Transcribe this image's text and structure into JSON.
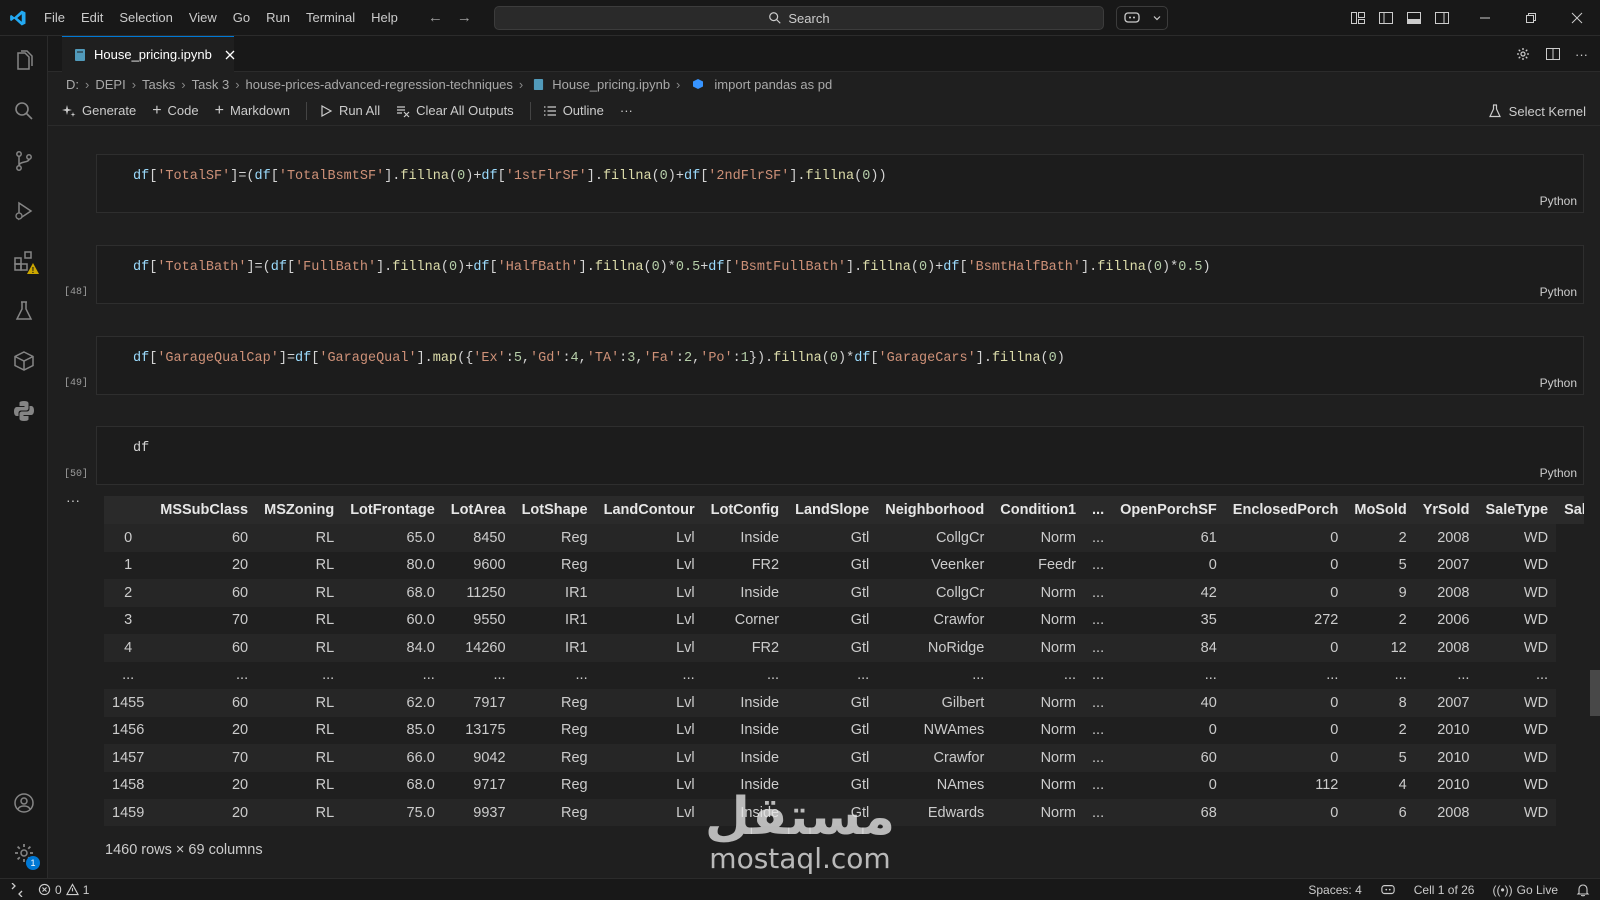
{
  "menu": [
    "File",
    "Edit",
    "Selection",
    "View",
    "Go",
    "Run",
    "Terminal",
    "Help"
  ],
  "search": {
    "label": "Search"
  },
  "tab": {
    "label": "House_pricing.ipynb"
  },
  "breadcrumb": [
    "D:",
    "DEPI",
    "Tasks",
    "Task 3",
    "house-prices-advanced-regression-techniques",
    "House_pricing.ipynb",
    "import pandas as pd"
  ],
  "toolbar": {
    "generate": "Generate",
    "code": "Code",
    "markdown": "Markdown",
    "run_all": "Run All",
    "clear_outputs": "Clear All Outputs",
    "outline": "Outline",
    "more": "···",
    "select_kernel": "Select Kernel"
  },
  "cells": [
    {
      "count": "",
      "lang": "Python"
    },
    {
      "count": "[48]",
      "lang": "Python"
    },
    {
      "count": "[49]",
      "lang": "Python"
    },
    {
      "count": "[50]",
      "lang": "Python",
      "code": "df"
    }
  ],
  "output": {
    "more": "···",
    "columns": [
      "",
      "MSSubClass",
      "MSZoning",
      "LotFrontage",
      "LotArea",
      "LotShape",
      "LandContour",
      "LotConfig",
      "LandSlope",
      "Neighborhood",
      "Condition1",
      "...",
      "OpenPorchSF",
      "EnclosedPorch",
      "MoSold",
      "YrSold",
      "SaleType",
      "SaleC"
    ],
    "rows": [
      [
        "0",
        "60",
        "RL",
        "65.0",
        "8450",
        "Reg",
        "Lvl",
        "Inside",
        "Gtl",
        "CollgCr",
        "Norm",
        "...",
        "61",
        "0",
        "2",
        "2008",
        "WD"
      ],
      [
        "1",
        "20",
        "RL",
        "80.0",
        "9600",
        "Reg",
        "Lvl",
        "FR2",
        "Gtl",
        "Veenker",
        "Feedr",
        "...",
        "0",
        "0",
        "5",
        "2007",
        "WD"
      ],
      [
        "2",
        "60",
        "RL",
        "68.0",
        "11250",
        "IR1",
        "Lvl",
        "Inside",
        "Gtl",
        "CollgCr",
        "Norm",
        "...",
        "42",
        "0",
        "9",
        "2008",
        "WD"
      ],
      [
        "3",
        "70",
        "RL",
        "60.0",
        "9550",
        "IR1",
        "Lvl",
        "Corner",
        "Gtl",
        "Crawfor",
        "Norm",
        "...",
        "35",
        "272",
        "2",
        "2006",
        "WD"
      ],
      [
        "4",
        "60",
        "RL",
        "84.0",
        "14260",
        "IR1",
        "Lvl",
        "FR2",
        "Gtl",
        "NoRidge",
        "Norm",
        "...",
        "84",
        "0",
        "12",
        "2008",
        "WD"
      ],
      [
        "...",
        "...",
        "...",
        "...",
        "...",
        "...",
        "...",
        "...",
        "...",
        "...",
        "...",
        "...",
        "...",
        "...",
        "...",
        "...",
        "..."
      ],
      [
        "1455",
        "60",
        "RL",
        "62.0",
        "7917",
        "Reg",
        "Lvl",
        "Inside",
        "Gtl",
        "Gilbert",
        "Norm",
        "...",
        "40",
        "0",
        "8",
        "2007",
        "WD"
      ],
      [
        "1456",
        "20",
        "RL",
        "85.0",
        "13175",
        "Reg",
        "Lvl",
        "Inside",
        "Gtl",
        "NWAmes",
        "Norm",
        "...",
        "0",
        "0",
        "2",
        "2010",
        "WD"
      ],
      [
        "1457",
        "70",
        "RL",
        "66.0",
        "9042",
        "Reg",
        "Lvl",
        "Inside",
        "Gtl",
        "Crawfor",
        "Norm",
        "...",
        "60",
        "0",
        "5",
        "2010",
        "WD"
      ],
      [
        "1458",
        "20",
        "RL",
        "68.0",
        "9717",
        "Reg",
        "Lvl",
        "Inside",
        "Gtl",
        "NAmes",
        "Norm",
        "...",
        "0",
        "112",
        "4",
        "2010",
        "WD"
      ],
      [
        "1459",
        "20",
        "RL",
        "75.0",
        "9937",
        "Reg",
        "Lvl",
        "Inside",
        "Gtl",
        "Edwards",
        "Norm",
        "...",
        "68",
        "0",
        "6",
        "2008",
        "WD"
      ]
    ],
    "shape": "1460 rows × 69 columns"
  },
  "watermark": {
    "arabic": "مستقل",
    "latin": "mostaql.com"
  },
  "status": {
    "errors": "0",
    "warnings": "1",
    "spaces": "Spaces: 4",
    "cell": "Cell 1 of 26",
    "go_live": "Go Live",
    "settings_badge": "1"
  },
  "colors": {
    "accent": "#0078d4",
    "string": "#ce9178",
    "number": "#b5cea8",
    "warning": "#cca700"
  }
}
